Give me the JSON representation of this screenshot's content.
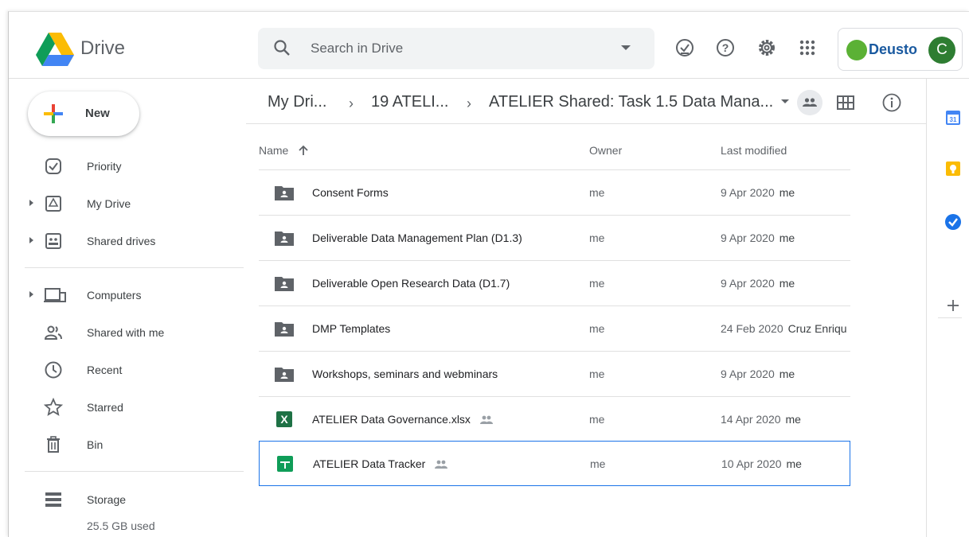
{
  "header": {
    "app_title": "Drive",
    "search_placeholder": "Search in Drive",
    "org_name": "Deusto",
    "avatar_letter": "C",
    "icons": [
      "ready-offline-icon",
      "help-icon",
      "settings-icon",
      "apps-icon"
    ]
  },
  "sidebar": {
    "new_label": "New",
    "items": [
      {
        "label": "Priority",
        "icon": "priority-icon",
        "expandable": false
      },
      {
        "label": "My Drive",
        "icon": "my-drive-icon",
        "expandable": true
      },
      {
        "label": "Shared drives",
        "icon": "shared-drives-icon",
        "expandable": true
      },
      {
        "label": "Computers",
        "icon": "computers-icon",
        "expandable": true
      },
      {
        "label": "Shared with me",
        "icon": "shared-with-me-icon",
        "expandable": false
      },
      {
        "label": "Recent",
        "icon": "clock-icon",
        "expandable": false
      },
      {
        "label": "Starred",
        "icon": "star-icon",
        "expandable": false
      },
      {
        "label": "Bin",
        "icon": "bin-icon",
        "expandable": false
      }
    ],
    "storage_label": "Storage",
    "storage_used": "25.5 GB used"
  },
  "breadcrumb": [
    "My Dri...",
    "19 ATELI...",
    "ATELIER Shared: Task 1.5 Data Mana..."
  ],
  "columns": {
    "name": "Name",
    "owner": "Owner",
    "modified": "Last modified"
  },
  "files": [
    {
      "name": "Consent Forms",
      "type": "shared-folder",
      "owner": "me",
      "modified": "9 Apr 2020",
      "modified_by": "me",
      "shared": false,
      "selected": false
    },
    {
      "name": "Deliverable Data Management Plan (D1.3)",
      "type": "shared-folder",
      "owner": "me",
      "modified": "9 Apr 2020",
      "modified_by": "me",
      "shared": false,
      "selected": false
    },
    {
      "name": "Deliverable Open Research Data (D1.7)",
      "type": "shared-folder",
      "owner": "me",
      "modified": "9 Apr 2020",
      "modified_by": "me",
      "shared": false,
      "selected": false
    },
    {
      "name": "DMP Templates",
      "type": "shared-folder",
      "owner": "me",
      "modified": "24 Feb 2020",
      "modified_by": "Cruz Enriqu",
      "shared": false,
      "selected": false
    },
    {
      "name": "Workshops, seminars and webminars",
      "type": "shared-folder",
      "owner": "me",
      "modified": "9 Apr 2020",
      "modified_by": "me",
      "shared": false,
      "selected": false
    },
    {
      "name": "ATELIER Data Governance.xlsx",
      "type": "excel",
      "owner": "me",
      "modified": "14 Apr 2020",
      "modified_by": "me",
      "shared": true,
      "selected": false
    },
    {
      "name": "ATELIER Data Tracker",
      "type": "sheets",
      "owner": "me",
      "modified": "10 Apr 2020",
      "modified_by": "me",
      "shared": true,
      "selected": true
    }
  ],
  "rail": [
    "calendar-icon",
    "keep-icon",
    "tasks-icon",
    "add-icon"
  ],
  "colors": {
    "accent": "#1a73e8",
    "excel": "#1e7145",
    "sheets": "#0f9d58",
    "avatar": "#2e7d32",
    "deusto": "#1a5aa0"
  }
}
